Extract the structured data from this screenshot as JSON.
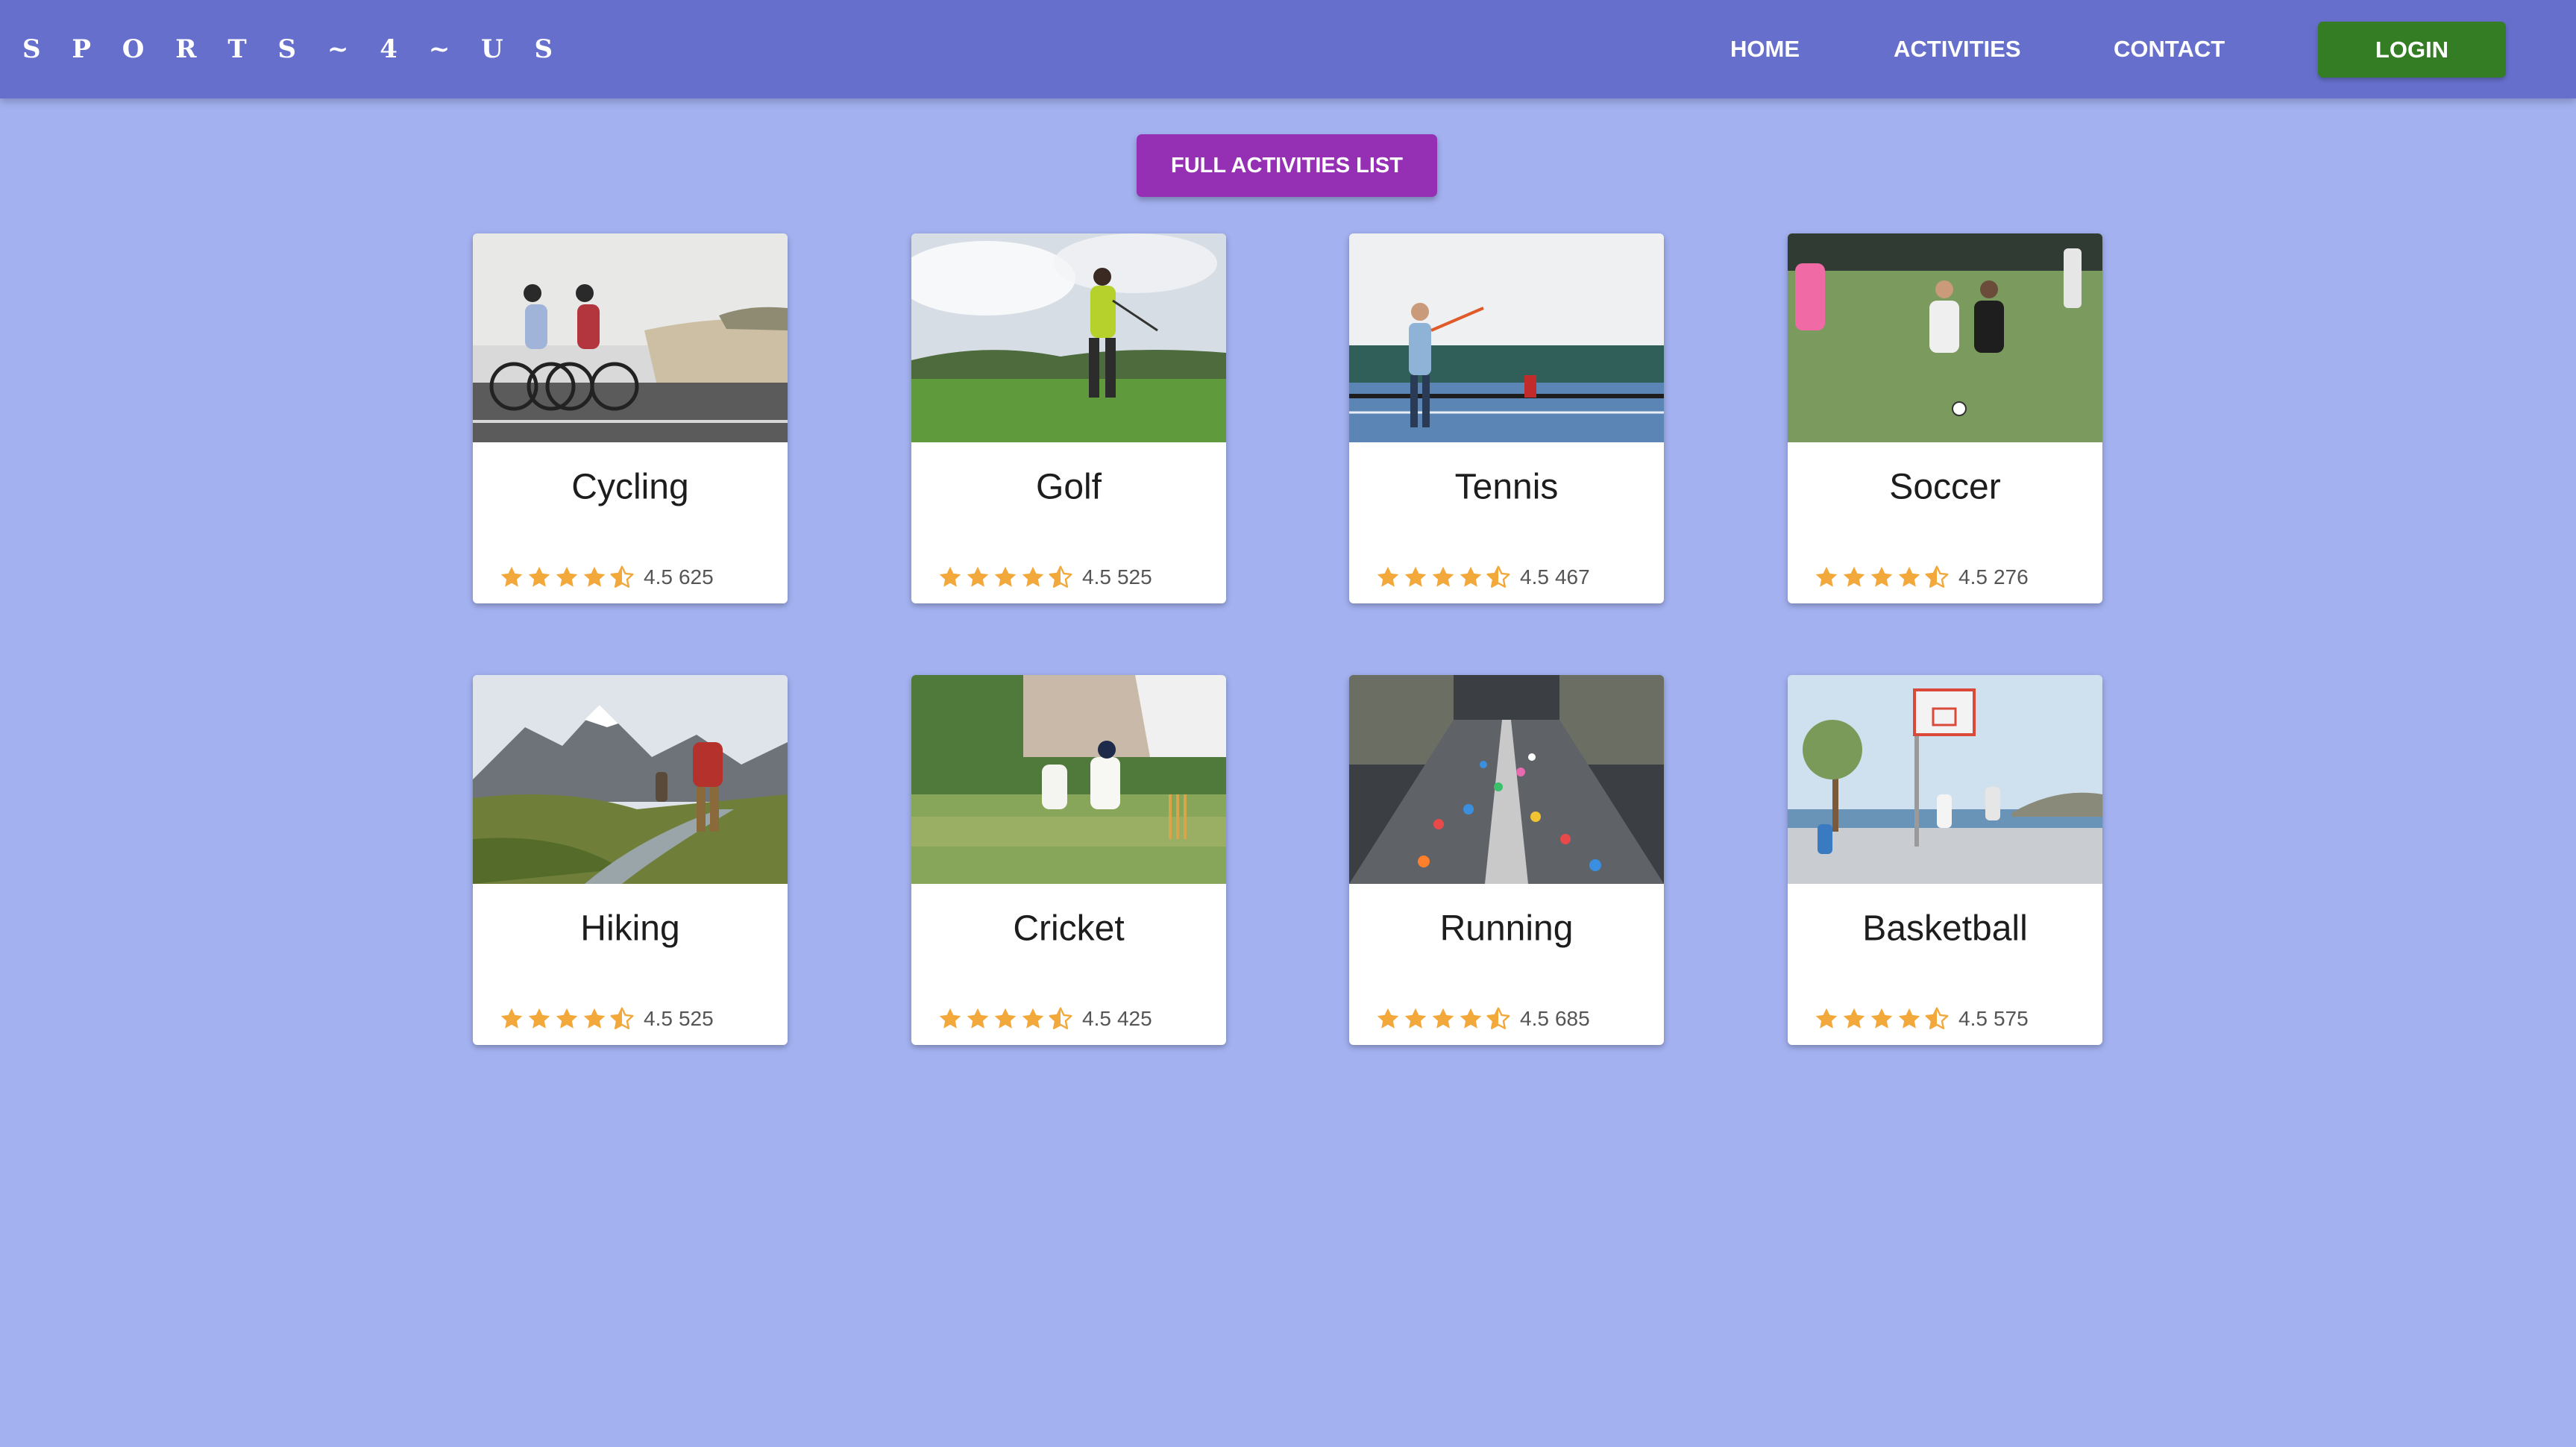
{
  "brand": "S P O R T S ~ 4 ~ U S",
  "nav": {
    "home": "HOME",
    "activities": "ACTIVITIES",
    "contact": "CONTACT",
    "login": "LOGIN"
  },
  "full_list_button": "FULL ACTIVITIES LIST",
  "colors": {
    "page_background": "#a3b1f0",
    "navbar": "#6670cc",
    "login_button": "#357d24",
    "full_list_button": "#9530b4",
    "star": "#f2a83b"
  },
  "activities": [
    {
      "title": "Cycling",
      "rating": "4.5",
      "count": "625",
      "stars": 4.5,
      "image": "cycling-photo"
    },
    {
      "title": "Golf",
      "rating": "4.5",
      "count": "525",
      "stars": 4.5,
      "image": "golf-photo"
    },
    {
      "title": "Tennis",
      "rating": "4.5",
      "count": "467",
      "stars": 4.5,
      "image": "tennis-photo"
    },
    {
      "title": "Soccer",
      "rating": "4.5",
      "count": "276",
      "stars": 4.5,
      "image": "soccer-photo"
    },
    {
      "title": "Hiking",
      "rating": "4.5",
      "count": "525",
      "stars": 4.5,
      "image": "hiking-photo"
    },
    {
      "title": "Cricket",
      "rating": "4.5",
      "count": "425",
      "stars": 4.5,
      "image": "cricket-photo"
    },
    {
      "title": "Running",
      "rating": "4.5",
      "count": "685",
      "stars": 4.5,
      "image": "running-photo"
    },
    {
      "title": "Basketball",
      "rating": "4.5",
      "count": "575",
      "stars": 4.5,
      "image": "basketball-photo"
    }
  ]
}
